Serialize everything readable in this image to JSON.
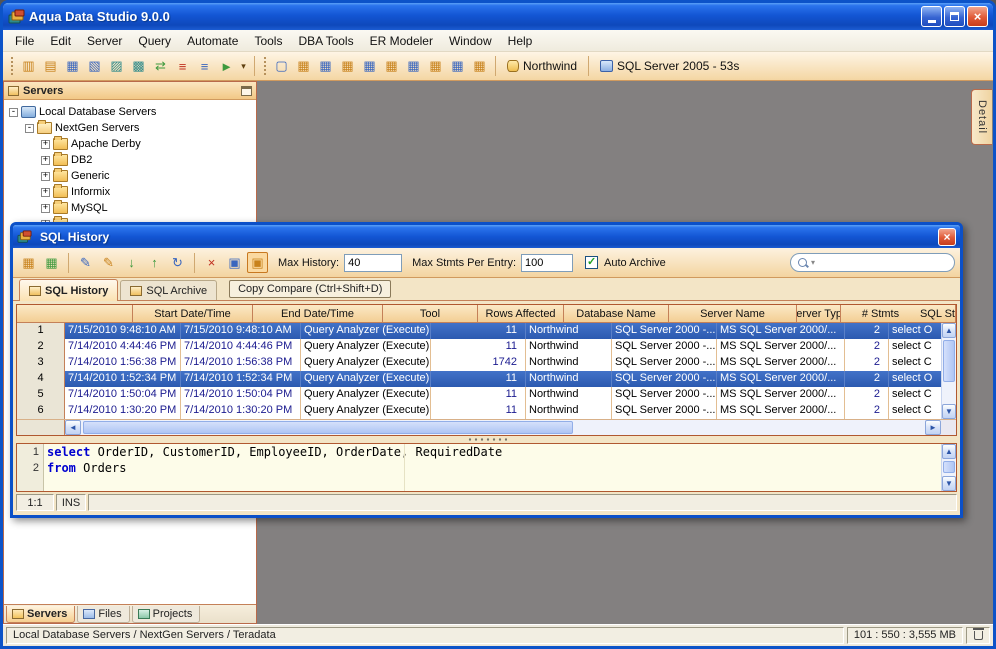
{
  "window": {
    "title": "Aqua Data Studio 9.0.0"
  },
  "icons": {
    "scroll_up": "▲",
    "scroll_down": "▼",
    "scroll_left": "◄",
    "scroll_right": "►",
    "dropdown": "▾",
    "close": "×",
    "check": "✓"
  },
  "menu": [
    {
      "name": "menu-file",
      "label": "File"
    },
    {
      "name": "menu-edit",
      "label": "Edit"
    },
    {
      "name": "menu-server",
      "label": "Server"
    },
    {
      "name": "menu-query",
      "label": "Query"
    },
    {
      "name": "menu-automate",
      "label": "Automate"
    },
    {
      "name": "menu-tools",
      "label": "Tools"
    },
    {
      "name": "menu-dba-tools",
      "label": "DBA Tools"
    },
    {
      "name": "menu-er-modeler",
      "label": "ER Modeler"
    },
    {
      "name": "menu-window",
      "label": "Window"
    },
    {
      "name": "menu-help",
      "label": "Help"
    }
  ],
  "toolbar": {
    "group1": [
      {
        "name": "register-server-icon",
        "glyph": "▥",
        "cls": "ic-amber"
      },
      {
        "name": "server-folder-icon",
        "glyph": "▤",
        "cls": "ic-amber"
      },
      {
        "name": "schema-browser-icon",
        "glyph": "▦",
        "cls": "ic-blue"
      },
      {
        "name": "query-analyzer-icon",
        "glyph": "▧",
        "cls": "ic-blue"
      },
      {
        "name": "query-builder-icon",
        "glyph": "▨",
        "cls": "ic-teal"
      },
      {
        "name": "table-data-tool-icon",
        "glyph": "▩",
        "cls": "ic-teal"
      },
      {
        "name": "import-export-tool-icon",
        "glyph": "⇄",
        "cls": "ic-green"
      },
      {
        "name": "compare-tool-icon",
        "glyph": "≡",
        "cls": "ic-red"
      },
      {
        "name": "script-tool-icon",
        "glyph": "≡",
        "cls": "ic-blue"
      },
      {
        "name": "automation-tool-icon",
        "glyph": "►",
        "cls": "ic-green"
      }
    ],
    "group2": [
      {
        "name": "new-query-window-icon",
        "glyph": "▢",
        "cls": "ic-blue"
      },
      {
        "name": "results-grid-icon",
        "glyph": "▦",
        "cls": "ic-amber"
      },
      {
        "name": "grid-text-view-icon",
        "glyph": "▦",
        "cls": "ic-blue"
      },
      {
        "name": "grid-form-view-icon",
        "glyph": "▦",
        "cls": "ic-amber"
      },
      {
        "name": "grid-pivot-icon",
        "glyph": "▦",
        "cls": "ic-blue"
      },
      {
        "name": "grid-filter-icon",
        "glyph": "▦",
        "cls": "ic-amber"
      },
      {
        "name": "grid-sort-icon",
        "glyph": "▦",
        "cls": "ic-blue"
      },
      {
        "name": "grid-aggregate-icon",
        "glyph": "▦",
        "cls": "ic-amber"
      },
      {
        "name": "grid-export-icon",
        "glyph": "▦",
        "cls": "ic-blue"
      },
      {
        "name": "grid-print-icon",
        "glyph": "▦",
        "cls": "ic-amber"
      }
    ],
    "database_label": "Northwind",
    "server_label": "SQL Server 2005 - 53s"
  },
  "servers_panel": {
    "title": "Servers",
    "tree": [
      {
        "expander": "-",
        "icon": "ico-dbservers",
        "label": "Local Database Servers",
        "_class": "lvl0"
      },
      {
        "expander": "-",
        "icon": "ico-folder-open",
        "label": "NextGen Servers",
        "_class": "lvl1"
      },
      {
        "expander": "+",
        "icon": "ico-folder",
        "label": "Apache Derby",
        "_class": "lvl2"
      },
      {
        "expander": "+",
        "icon": "ico-folder",
        "label": "DB2",
        "_class": "lvl2"
      },
      {
        "expander": "+",
        "icon": "ico-folder",
        "label": "Generic",
        "_class": "lvl2"
      },
      {
        "expander": "+",
        "icon": "ico-folder",
        "label": "Informix",
        "_class": "lvl2"
      },
      {
        "expander": "+",
        "icon": "ico-folder",
        "label": "MySQL",
        "_class": "lvl2"
      },
      {
        "expander": "+",
        "icon": "ico-folder",
        "label": "",
        "_class": "lvl2"
      }
    ],
    "tabs": [
      {
        "name": "panel-tab-servers",
        "label": "Servers",
        "icon": "ti-servers",
        "_class": "active"
      },
      {
        "name": "panel-tab-files",
        "label": "Files",
        "icon": "ti-files"
      },
      {
        "name": "panel-tab-projects",
        "label": "Projects",
        "icon": "ti-projects"
      }
    ]
  },
  "detail_tab_label": "Detail",
  "dialog": {
    "title": "SQL History",
    "toolbar": {
      "group1": [
        {
          "name": "view-grid-icon",
          "glyph": "▦",
          "cls": "ic-amber"
        },
        {
          "name": "view-grid-add-icon",
          "glyph": "▦",
          "cls": "ic-green"
        }
      ],
      "group2": [
        {
          "name": "edit-entry-icon",
          "glyph": "✎",
          "cls": "ic-blue"
        },
        {
          "name": "copy-entry-icon",
          "glyph": "✎",
          "cls": "ic-amber"
        },
        {
          "name": "export-entries-icon",
          "glyph": "↓",
          "cls": "ic-green"
        },
        {
          "name": "import-entries-icon",
          "glyph": "↑",
          "cls": "ic-green"
        },
        {
          "name": "refresh-entries-icon",
          "glyph": "↻",
          "cls": "ic-blue"
        }
      ],
      "group3": [
        {
          "name": "delete-entry-icon",
          "glyph": "×",
          "cls": "ic-red"
        },
        {
          "name": "open-in-window-icon",
          "glyph": "▣",
          "cls": "ic-blue"
        },
        {
          "name": "toggle-sql-pane-icon",
          "glyph": "▣",
          "cls": "ic-amber",
          "_class": "pressed"
        }
      ],
      "max_history_label": "Max History:",
      "max_history_value": "40",
      "max_stmts_label": "Max Stmts Per Entry:",
      "max_stmts_value": "100",
      "auto_archive_label": "Auto Archive"
    },
    "tabs": [
      {
        "name": "tab-sql-history",
        "label": "SQL History",
        "_class": "active"
      },
      {
        "name": "tab-sql-archive",
        "label": "SQL Archive"
      }
    ],
    "copy_compare_label": "Copy Compare (Ctrl+Shift+D)",
    "table": {
      "headers": [
        "",
        "Start Date/Time",
        "End Date/Time",
        "Tool",
        "Rows Affected",
        "Database Name",
        "Server Name",
        "Server Type",
        "# Stmts",
        "SQL St"
      ],
      "rows": [
        {
          "_class": "selected",
          "cells": [
            "1",
            "7/15/2010 9:48:10 AM",
            "7/15/2010 9:48:10 AM",
            "Query Analyzer (Execute)",
            "11",
            "Northwind",
            "SQL Server 2000 -...",
            "MS SQL Server 2000/...",
            "2",
            "select O"
          ]
        },
        {
          "cells": [
            "2",
            "7/14/2010 4:44:46 PM",
            "7/14/2010 4:44:46 PM",
            "Query Analyzer (Execute)",
            "11",
            "Northwind",
            "SQL Server 2000 -...",
            "MS SQL Server 2000/...",
            "2",
            "select C"
          ]
        },
        {
          "cells": [
            "3",
            "7/14/2010 1:56:38 PM",
            "7/14/2010 1:56:38 PM",
            "Query Analyzer (Execute)",
            "1742",
            "Northwind",
            "SQL Server 2000 -...",
            "MS SQL Server 2000/...",
            "2",
            "select C"
          ]
        },
        {
          "_class": "selected",
          "cells": [
            "4",
            "7/14/2010 1:52:34 PM",
            "7/14/2010 1:52:34 PM",
            "Query Analyzer (Execute)",
            "11",
            "Northwind",
            "SQL Server 2000 -...",
            "MS SQL Server 2000/...",
            "2",
            "select O"
          ]
        },
        {
          "cells": [
            "5",
            "7/14/2010 1:50:04 PM",
            "7/14/2010 1:50:04 PM",
            "Query Analyzer (Execute)",
            "11",
            "Northwind",
            "SQL Server 2000 -...",
            "MS SQL Server 2000/...",
            "2",
            "select C"
          ]
        },
        {
          "cells": [
            "6",
            "7/14/2010 1:30:20 PM",
            "7/14/2010 1:30:20 PM",
            "Query Analyzer (Execute)",
            "11",
            "Northwind",
            "SQL Server 2000 -...",
            "MS SQL Server 2000/...",
            "2",
            "select C"
          ]
        }
      ]
    },
    "editor": {
      "lines": [
        {
          "num": "1",
          "keyword": "select",
          "rest": " OrderID, CustomerID, EmployeeID, OrderDate, RequiredDate"
        },
        {
          "num": "2",
          "keyword": "from",
          "rest": " Orders"
        }
      ],
      "cursor_pos": "1:1",
      "mode": "INS"
    }
  },
  "statusbar": {
    "path": "Local Database Servers / NextGen Servers / Teradata",
    "stats": "101 : 550 : 3,555 MB"
  }
}
